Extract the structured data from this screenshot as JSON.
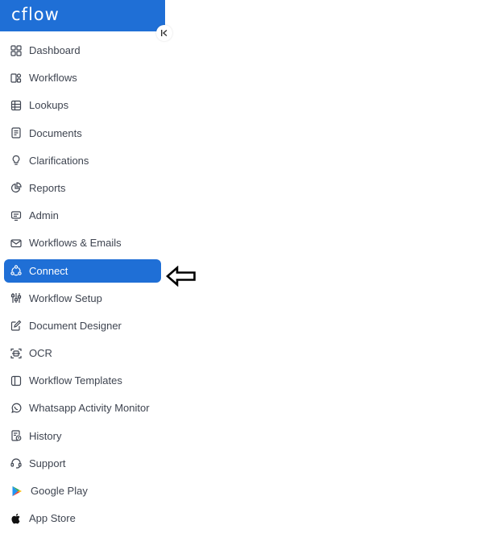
{
  "app": {
    "logo_text": "cflow"
  },
  "colors": {
    "brand": "#1f6fd6",
    "text": "#3e4450",
    "active_text": "#ffffff"
  },
  "sidebar": {
    "items": [
      {
        "label": "Dashboard",
        "icon": "dashboard-icon"
      },
      {
        "label": "Workflows",
        "icon": "workflows-icon"
      },
      {
        "label": "Lookups",
        "icon": "lookups-icon"
      },
      {
        "label": "Documents",
        "icon": "documents-icon"
      },
      {
        "label": "Clarifications",
        "icon": "clarifications-icon"
      },
      {
        "label": "Reports",
        "icon": "reports-icon"
      },
      {
        "label": "Admin",
        "icon": "admin-icon"
      },
      {
        "label": "Workflows & Emails",
        "icon": "mail-icon"
      },
      {
        "label": "Connect",
        "icon": "connect-icon",
        "active": true
      },
      {
        "label": "Workflow Setup",
        "icon": "sliders-icon"
      },
      {
        "label": "Document Designer",
        "icon": "edit-document-icon"
      },
      {
        "label": "OCR",
        "icon": "ocr-icon"
      },
      {
        "label": "Workflow Templates",
        "icon": "templates-icon"
      },
      {
        "label": "Whatsapp Activity Monitor",
        "icon": "whatsapp-icon"
      },
      {
        "label": "History",
        "icon": "history-icon"
      },
      {
        "label": "Support",
        "icon": "support-icon"
      },
      {
        "label": "Google Play",
        "icon": "google-play-icon"
      },
      {
        "label": "App Store",
        "icon": "apple-icon"
      }
    ]
  },
  "annotation": {
    "icon": "left-arrow-icon",
    "points_to": "Connect"
  }
}
